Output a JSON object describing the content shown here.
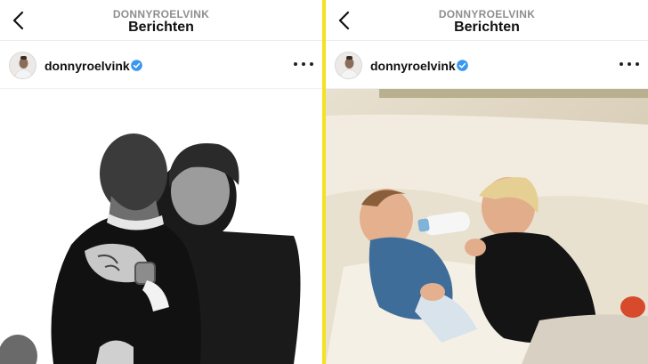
{
  "screens": [
    {
      "header": {
        "account": "DONNYROELVINK",
        "title": "Berichten"
      },
      "post": {
        "username": "donnyroelvink",
        "verified": true
      }
    },
    {
      "header": {
        "account": "DONNYROELVINK",
        "title": "Berichten"
      },
      "post": {
        "username": "donnyroelvink",
        "verified": true
      }
    }
  ],
  "colors": {
    "divider": "#f5e11f",
    "verified_badge": "#3897f0"
  },
  "icons": [
    "back-icon",
    "verified-badge-icon",
    "more-options-icon"
  ]
}
